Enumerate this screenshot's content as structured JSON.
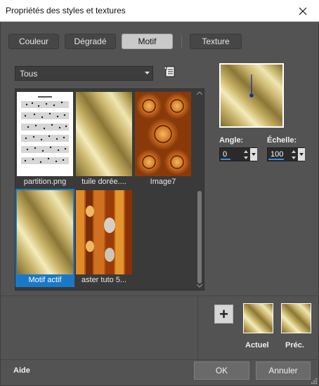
{
  "window": {
    "title": "Propriétés des styles et textures"
  },
  "tabs": [
    {
      "label": "Couleur",
      "active": false
    },
    {
      "label": "Dégradé",
      "active": false
    },
    {
      "label": "Motif",
      "active": true
    },
    {
      "label": "Texture",
      "active": false
    }
  ],
  "category_select": {
    "value": "Tous"
  },
  "patterns": [
    {
      "label": "partition.png",
      "kind": "sheet-music",
      "selected": false
    },
    {
      "label": "tuile dorée....",
      "kind": "gold",
      "selected": false
    },
    {
      "label": "Image7",
      "kind": "orange-ornament",
      "selected": false
    },
    {
      "label": "Motif actif",
      "kind": "gold",
      "selected": true
    },
    {
      "label": "aster tuto 5...",
      "kind": "orange-strips",
      "selected": false
    }
  ],
  "angle": {
    "label": "Angle:",
    "value": "0"
  },
  "scale": {
    "label": "Échelle:",
    "value": "100"
  },
  "swatches": {
    "current_label": "Actuel",
    "previous_label": "Préc."
  },
  "footer": {
    "help_label": "Aide",
    "ok_label": "OK",
    "cancel_label": "Annuler"
  },
  "colors": {
    "accent": "#1979c9",
    "dialog_bg": "#535353",
    "panel_bg": "#3a3a3a"
  },
  "icons": {
    "close": "close-icon",
    "browse": "browse-icon",
    "dropdown": "chevron-down-icon",
    "plus": "plus-icon",
    "grip": "resize-grip-icon"
  }
}
